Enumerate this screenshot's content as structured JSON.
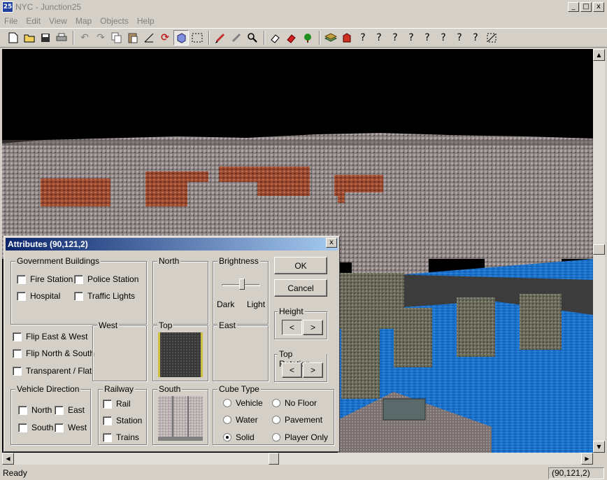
{
  "window": {
    "icon_text": "25",
    "title": "NYC - Junction25",
    "min": "_",
    "max": "□",
    "close": "x"
  },
  "menu": [
    "File",
    "Edit",
    "View",
    "Map",
    "Objects",
    "Help"
  ],
  "status": {
    "text": "Ready",
    "coords": "(90,121,2)"
  },
  "dialog": {
    "title": "Attributes (90,121,2)",
    "close": "x",
    "government": {
      "label": "Government Buildings",
      "fire_station": "Fire Station",
      "police_station": "Police Station",
      "hospital": "Hospital",
      "traffic_lights": "Traffic Lights"
    },
    "north": "North",
    "brightness": {
      "label": "Brightness",
      "dark": "Dark",
      "light": "Light",
      "level": 0.55
    },
    "ok": "OK",
    "cancel": "Cancel",
    "height": {
      "label": "Height",
      "left": "<",
      "right": ">"
    },
    "top_rotation": {
      "label": "Top Rotation",
      "left": "<",
      "right": ">"
    },
    "flip_ew": "Flip East & West",
    "flip_ns": "Flip North & South",
    "transparent": "Transparent / Flat",
    "west": "West",
    "top": "Top",
    "east": "East",
    "vehicle_direction": {
      "label": "Vehicle Direction",
      "north": "North",
      "east": "East",
      "south": "South",
      "west": "West"
    },
    "railway": {
      "label": "Railway",
      "rail": "Rail",
      "station": "Station",
      "trains": "Trains"
    },
    "south": "South",
    "cube_type": {
      "label": "Cube Type",
      "vehicle": "Vehicle",
      "no_floor": "No Floor",
      "water": "Water",
      "pavement": "Pavement",
      "solid": "Solid",
      "player_only": "Player Only",
      "selected": "Solid"
    }
  }
}
